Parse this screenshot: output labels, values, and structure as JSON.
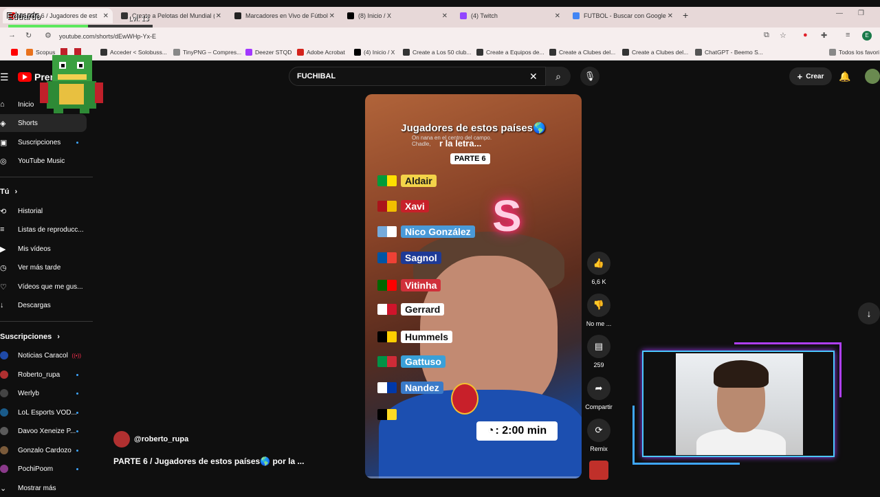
{
  "overlay": {
    "name": "Eduardo",
    "level": "Lvl: 13",
    "xp_fraction": 0.55
  },
  "tabs": [
    {
      "label": "PARTE 6 / Jugadores de est",
      "active": true,
      "color": "#ff0000"
    },
    {
      "label": "Create a Pelotas del Mundial (2",
      "active": false,
      "color": "#333333"
    },
    {
      "label": "Marcadores en Vivo de Fútbol,",
      "active": false,
      "color": "#222222"
    },
    {
      "label": "(8) Inicio / X",
      "active": false,
      "color": "#000000"
    },
    {
      "label": "(4) Twitch",
      "active": false,
      "color": "#9146ff"
    },
    {
      "label": "FUTBOL - Buscar con Google",
      "active": false,
      "color": "#4285f4"
    }
  ],
  "url": "youtube.com/shorts/dEwWHp-Yx-E",
  "bookmarks": [
    {
      "label": "Scopus",
      "color": "#e9711c"
    },
    {
      "label": "Acceder < Solobuss...",
      "color": "#333333"
    },
    {
      "label": "TinyPNG – Compres...",
      "color": "#888888"
    },
    {
      "label": "Deezer STQD",
      "color": "#a238ff"
    },
    {
      "label": "Adobe Acrobat",
      "color": "#d4231c"
    },
    {
      "label": "(4) Inicio / X",
      "color": "#000000"
    },
    {
      "label": "Create a Los 50 club...",
      "color": "#333333"
    },
    {
      "label": "Create a Equipos de...",
      "color": "#333333"
    },
    {
      "label": "Create a Clubes del...",
      "color": "#333333"
    },
    {
      "label": "Create a Clubes del...",
      "color": "#333333"
    },
    {
      "label": "ChatGPT - Beemo S...",
      "color": "#555555"
    },
    {
      "label": "Todos los favori",
      "color": "#888888"
    }
  ],
  "header": {
    "logo": "Premium",
    "search_value": "FUCHIBAL",
    "create": "Crear"
  },
  "sidebar": {
    "main": [
      {
        "label": "Inicio",
        "icon": "home-icon"
      },
      {
        "label": "Shorts",
        "icon": "shorts-icon"
      },
      {
        "label": "Suscripciones",
        "icon": "subscriptions-icon"
      },
      {
        "label": "YouTube Music",
        "icon": "music-icon"
      }
    ],
    "you_heading": "Tú",
    "you": [
      {
        "label": "Historial"
      },
      {
        "label": "Listas de reproducc..."
      },
      {
        "label": "Mis vídeos"
      },
      {
        "label": "Ver más tarde"
      },
      {
        "label": "Vídeos que me gus..."
      },
      {
        "label": "Descargas"
      }
    ],
    "subs_heading": "Suscripciones",
    "subs": [
      {
        "label": "Noticias Caracol",
        "color": "#1f4aa8"
      },
      {
        "label": "Roberto_rupa",
        "color": "#b03030"
      },
      {
        "label": "Werlyb",
        "color": "#444444"
      },
      {
        "label": "LoL Esports VOD...",
        "color": "#1a5b8a"
      },
      {
        "label": "Davoo Xeneize P...",
        "color": "#5a5a5a"
      },
      {
        "label": "Gonzalo Cardozo",
        "color": "#7a5a3a"
      },
      {
        "label": "PochiPoom",
        "color": "#8a3a8a"
      }
    ],
    "more": "Mostrar más"
  },
  "video": {
    "title": "Jugadores de estos países🌎",
    "subtitle_line1": "On nana en el centro del campo.",
    "subtitle_line2": "Chadle,",
    "subtitle_big": "r la letra...",
    "parte": "PARTE 6",
    "letter": "S",
    "players": [
      {
        "name": "Aldair",
        "flag": [
          "#009b3a",
          "#fedf00"
        ],
        "bg": "#f3d349",
        "fg": "#1a1a1a"
      },
      {
        "name": "Xavi",
        "flag": [
          "#aa151b",
          "#f1bf00"
        ],
        "bg": "#c8202a",
        "fg": "#ffffff"
      },
      {
        "name": "Nico González",
        "flag": [
          "#75aadb",
          "#ffffff"
        ],
        "bg": "#4a9ad8",
        "fg": "#ffffff"
      },
      {
        "name": "Sagnol",
        "flag": [
          "#0055a4",
          "#ef4135"
        ],
        "bg": "#1e3a96",
        "fg": "#ffffff"
      },
      {
        "name": "Vitinha",
        "flag": [
          "#006600",
          "#ff0000"
        ],
        "bg": "#d0303a",
        "fg": "#ffffff"
      },
      {
        "name": "Gerrard",
        "flag": [
          "#ffffff",
          "#cf142b"
        ],
        "bg": "#ffffff",
        "fg": "#111111"
      },
      {
        "name": "Hummels",
        "flag": [
          "#000000",
          "#ffce00"
        ],
        "bg": "#ffffff",
        "fg": "#111111"
      },
      {
        "name": "Gattuso",
        "flag": [
          "#009246",
          "#ce2b37"
        ],
        "bg": "#3aa0d8",
        "fg": "#ffffff"
      },
      {
        "name": "Nandez",
        "flag": [
          "#ffffff",
          "#0038a8"
        ],
        "bg": "#3a7ac8",
        "fg": "#ffffff"
      },
      {
        "name": "",
        "flag": [
          "#000000",
          "#fdda24"
        ],
        "bg": "transparent",
        "fg": "#ffffff"
      }
    ],
    "timer": ": 2:00 min",
    "progress_fraction": 0.0
  },
  "actions": {
    "likes": "6,6 K",
    "dislike": "No me ...",
    "comments": "259",
    "share": "Compartir",
    "remix": "Remix"
  },
  "channel": {
    "handle": "@roberto_rupa"
  },
  "video_title": "PARTE 6 / Jugadores de estos países🌎 por la ..."
}
